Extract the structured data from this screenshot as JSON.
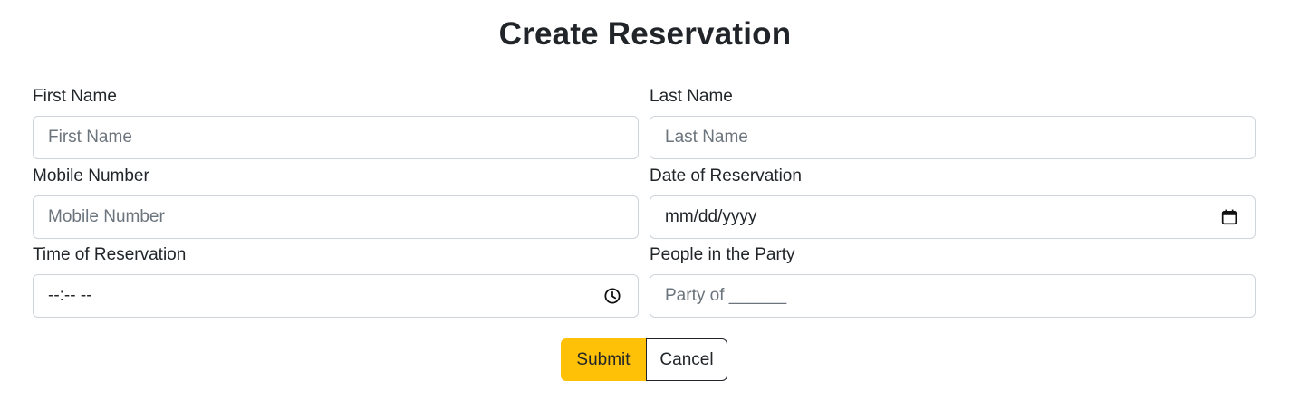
{
  "form": {
    "title": "Create Reservation",
    "fields": {
      "first_name": {
        "label": "First Name",
        "placeholder": "First Name"
      },
      "last_name": {
        "label": "Last Name",
        "placeholder": "Last Name"
      },
      "mobile": {
        "label": "Mobile Number",
        "placeholder": "Mobile Number"
      },
      "date": {
        "label": "Date of Reservation",
        "placeholder": "mm/dd/yyyy",
        "icon": "calendar-icon"
      },
      "time": {
        "label": "Time of Reservation",
        "placeholder": "--:-- --",
        "icon": "clock-icon"
      },
      "party": {
        "label": "People in the Party",
        "placeholder": "Party of ______"
      }
    },
    "buttons": {
      "submit": "Submit",
      "cancel": "Cancel"
    },
    "colors": {
      "submit_bg": "#ffc107",
      "border": "#ced4da",
      "text": "#212529",
      "placeholder": "#6c757d"
    }
  }
}
